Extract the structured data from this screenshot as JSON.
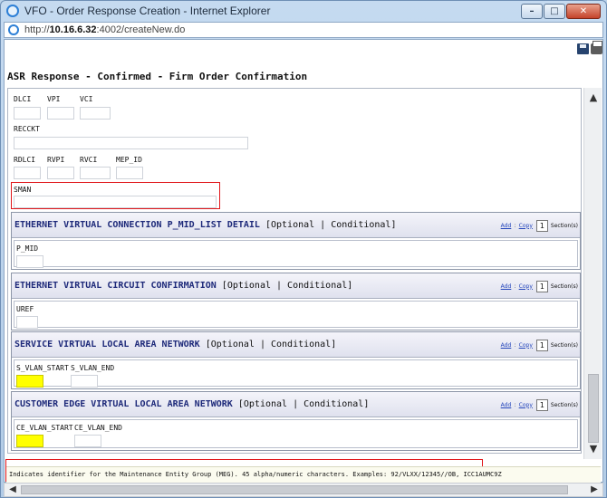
{
  "window": {
    "title": "VFO - Order Response Creation - Internet Explorer",
    "url_prefix": "http://",
    "url_host": "10.16.6.32",
    "url_rest": ":4002/createNew.do",
    "minimize_glyph": "–",
    "maximize_glyph": "□",
    "close_glyph": "✕"
  },
  "toolbar": {
    "save_icon": "save-icon",
    "print_icon": "print-icon"
  },
  "page": {
    "title": "ASR Response - Confirmed - Firm Order Confirmation"
  },
  "top_fields": {
    "dlci": "DLCI",
    "vpi": "VPI",
    "vci": "VCI",
    "recckt": "RECCKT",
    "rdlci": "RDLCI",
    "rvpi": "RVPI",
    "rvci": "RVCI",
    "mep_id": "MEP_ID",
    "sman": "SMAN"
  },
  "common": {
    "optional": "[Optional | Conditional]",
    "add": "Add",
    "copy": "Copy",
    "section_suffix": "Section(s)",
    "sep": ":"
  },
  "sections": [
    {
      "name": "ETHERNET VIRTUAL CONNECTION P_MID_LIST DETAIL",
      "count": "1",
      "fields": [
        "P_MID"
      ]
    },
    {
      "name": "ETHERNET VIRTUAL CIRCUIT CONFIRMATION",
      "count": "1",
      "fields": [
        "UREF"
      ]
    },
    {
      "name": "SERVICE VIRTUAL LOCAL AREA NETWORK",
      "count": "1",
      "fields": [
        "S_VLAN_START",
        "S_VLAN_END"
      ]
    },
    {
      "name": "CUSTOMER EDGE VIRTUAL LOCAL AREA NETWORK",
      "count": "1",
      "fields": [
        "CE_VLAN_START",
        "CE_VLAN_END"
      ]
    }
  ],
  "status": {
    "text": "Indicates identifier for the Maintenance Entity Group (MEG). 45 alpha/numeric characters. Examples: 92/VLXX/12345//OB, ICC1AUMC9Z"
  },
  "colors": {
    "highlight": "#ffff00",
    "callout": "#e0161a",
    "link": "#2244bb"
  }
}
